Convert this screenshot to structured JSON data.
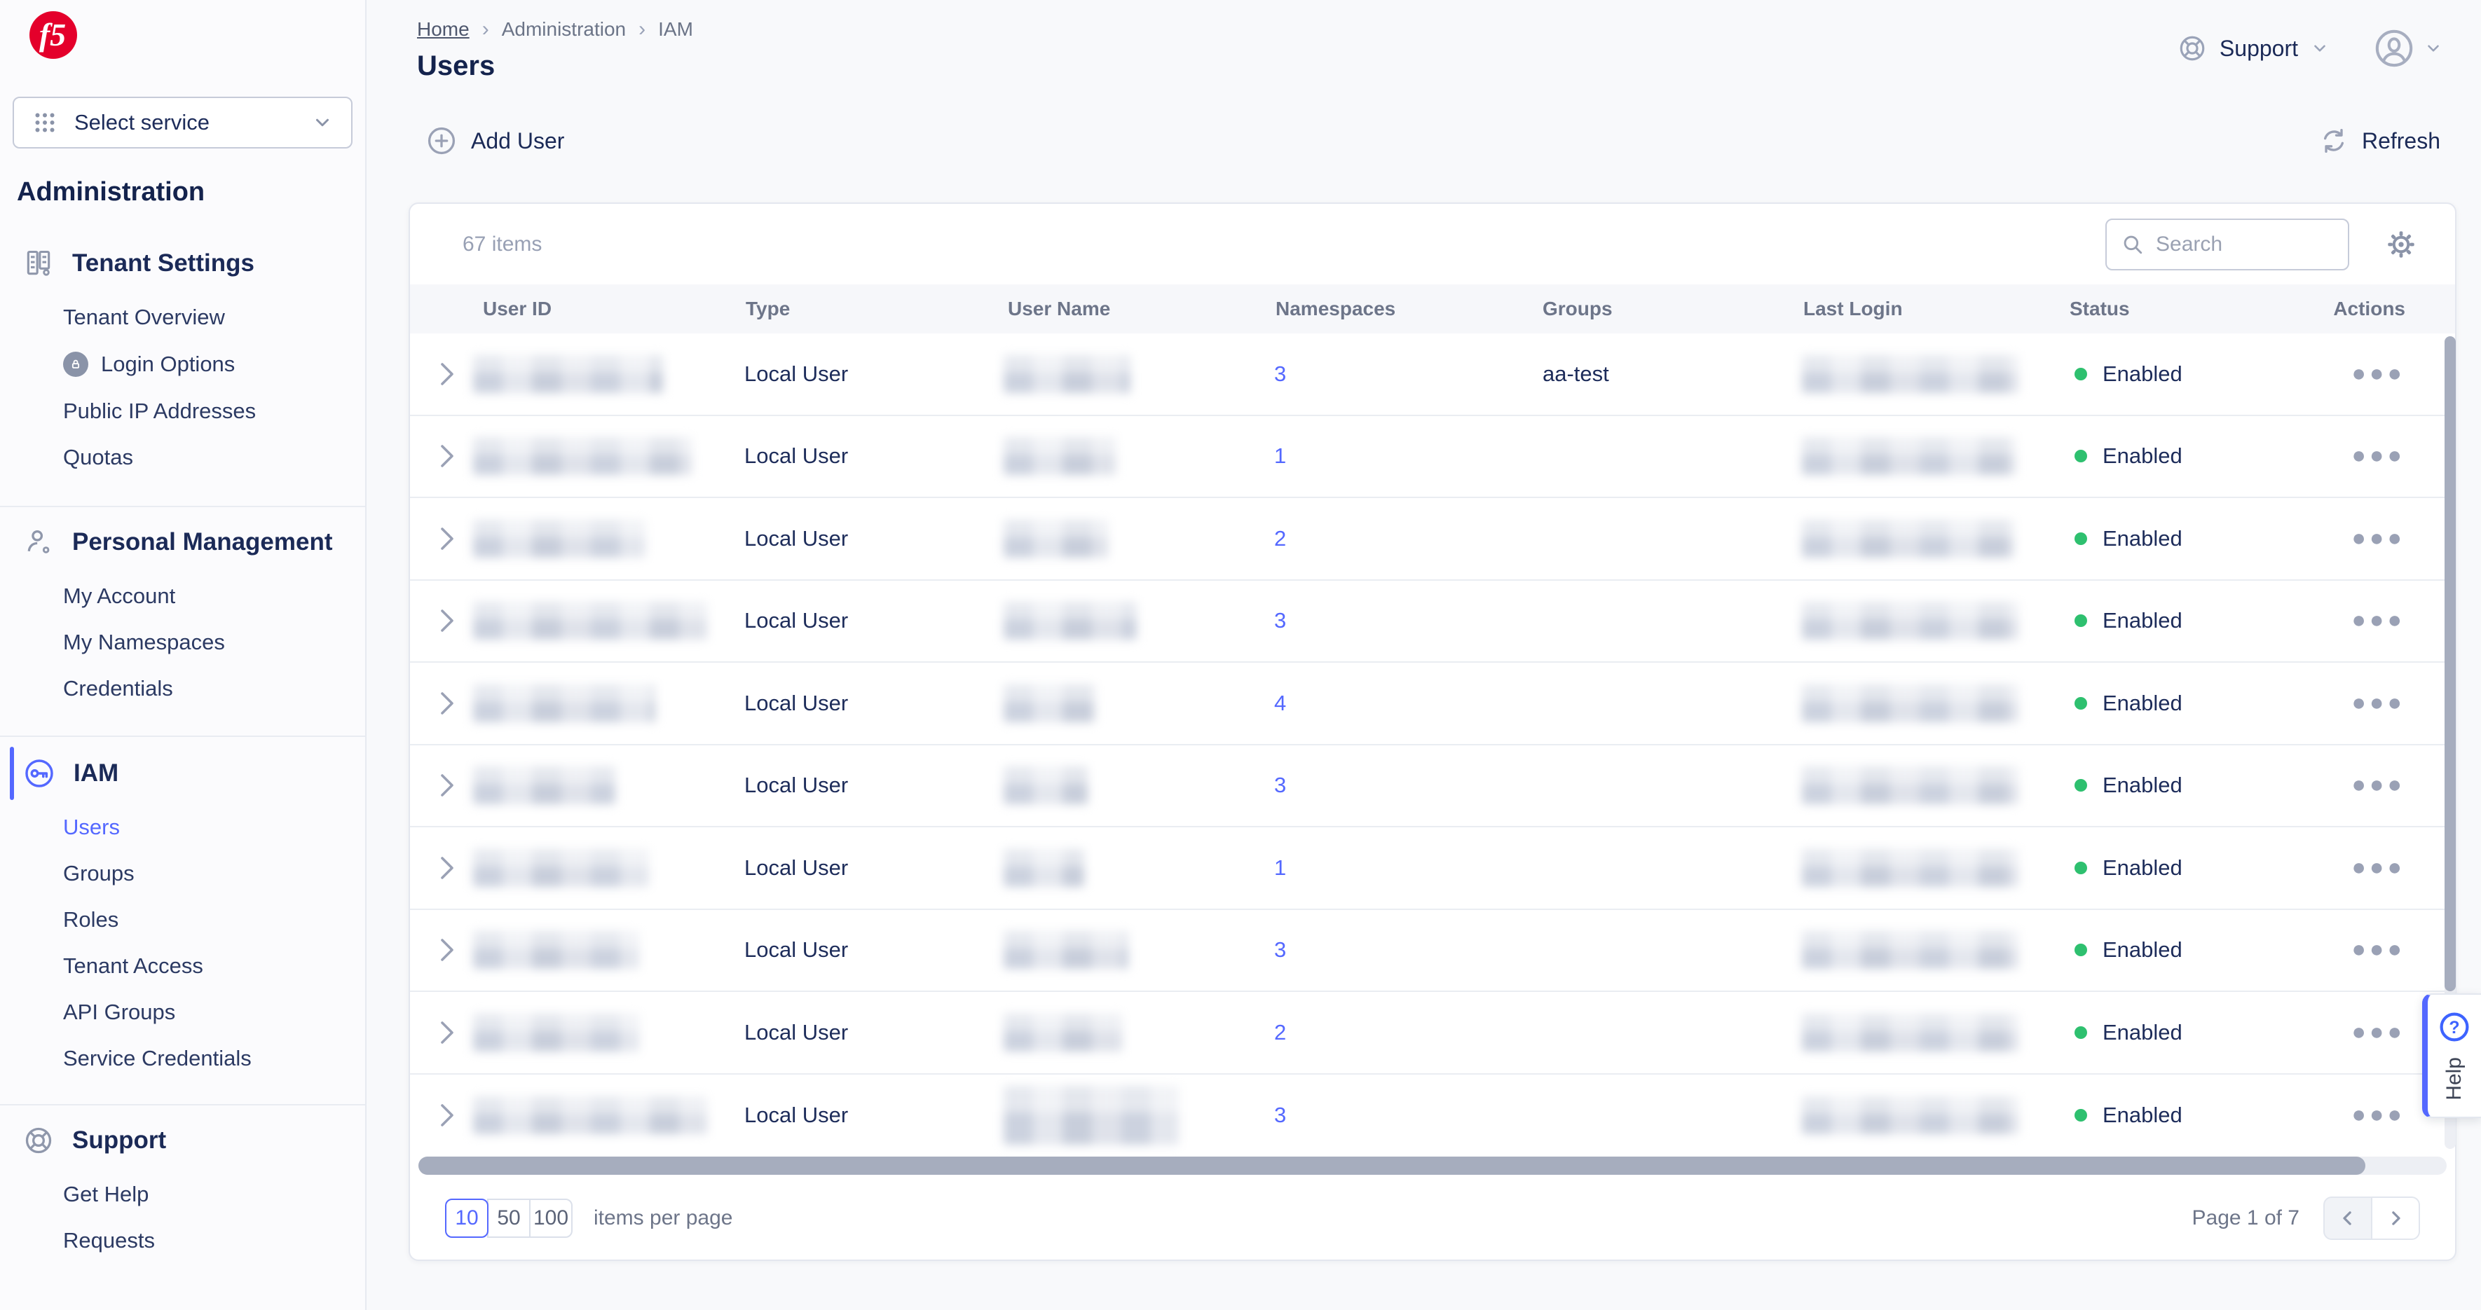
{
  "colors": {
    "accent": "#5468ff",
    "status_enabled_green": "#2ec06f",
    "brand_red": "#e4002b"
  },
  "sidebar": {
    "select_service_label": "Select service",
    "title": "Administration",
    "groups": [
      {
        "title": "Tenant Settings",
        "items": [
          "Tenant Overview",
          "Login Options",
          "Public IP Addresses",
          "Quotas"
        ]
      },
      {
        "title": "Personal Management",
        "items": [
          "My Account",
          "My Namespaces",
          "Credentials"
        ]
      },
      {
        "title": "IAM",
        "active_item": "Users",
        "items": [
          "Users",
          "Groups",
          "Roles",
          "Tenant Access",
          "API Groups",
          "Service Credentials"
        ]
      },
      {
        "title": "Support",
        "items": [
          "Get Help",
          "Requests"
        ]
      }
    ]
  },
  "header": {
    "breadcrumb": [
      "Home",
      "Administration",
      "IAM"
    ],
    "title": "Users",
    "support_label": "Support"
  },
  "toolbar": {
    "add_user_label": "Add User",
    "refresh_label": "Refresh"
  },
  "table": {
    "items_count": "67 items",
    "search_placeholder": "Search",
    "columns": [
      "User ID",
      "Type",
      "User Name",
      "Namespaces",
      "Groups",
      "Last Login",
      "Status",
      "Actions"
    ],
    "rows": [
      {
        "type": "Local User",
        "namespaces": "3",
        "groups": "aa-test",
        "status": "Enabled",
        "redact": {
          "id_w": 271,
          "name_w": 181,
          "login_w": 309
        }
      },
      {
        "type": "Local User",
        "namespaces": "1",
        "groups": "",
        "status": "Enabled",
        "redact": {
          "id_w": 312,
          "name_w": 160,
          "login_w": 305
        }
      },
      {
        "type": "Local User",
        "namespaces": "2",
        "groups": "",
        "status": "Enabled",
        "redact": {
          "id_w": 246,
          "name_w": 149,
          "login_w": 303
        }
      },
      {
        "type": "Local User",
        "namespaces": "3",
        "groups": "",
        "status": "Enabled",
        "redact": {
          "id_w": 334,
          "name_w": 190,
          "login_w": 309
        }
      },
      {
        "type": "Local User",
        "namespaces": "4",
        "groups": "",
        "status": "Enabled",
        "redact": {
          "id_w": 260,
          "name_w": 131,
          "login_w": 309
        }
      },
      {
        "type": "Local User",
        "namespaces": "3",
        "groups": "",
        "status": "Enabled",
        "redact": {
          "id_w": 203,
          "name_w": 120,
          "login_w": 309
        }
      },
      {
        "type": "Local User",
        "namespaces": "1",
        "groups": "",
        "status": "Enabled",
        "redact": {
          "id_w": 251,
          "name_w": 115,
          "login_w": 309
        }
      },
      {
        "type": "Local User",
        "namespaces": "3",
        "groups": "",
        "status": "Enabled",
        "redact": {
          "id_w": 237,
          "name_w": 178,
          "login_w": 309
        }
      },
      {
        "type": "Local User",
        "namespaces": "2",
        "groups": "",
        "status": "Enabled",
        "redact": {
          "id_w": 237,
          "name_w": 169,
          "login_w": 309
        }
      },
      {
        "type": "Local User",
        "namespaces": "3",
        "groups": "",
        "status": "Enabled",
        "redact": {
          "id_w": 334,
          "name_w": 250,
          "name_h": 84,
          "login_w": 309
        }
      }
    ]
  },
  "pagination": {
    "sizes": [
      "10",
      "50",
      "100"
    ],
    "active_size": "10",
    "items_per_page_label": "items per page",
    "page_label": "Page 1 of 7"
  },
  "help": {
    "label": "Help"
  }
}
